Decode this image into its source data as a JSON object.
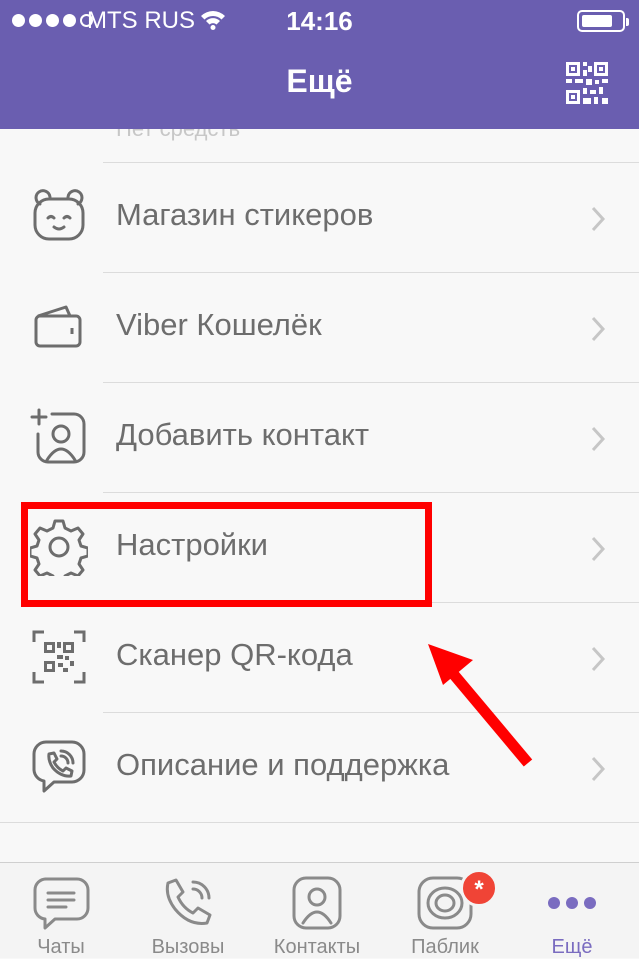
{
  "status_bar": {
    "carrier": "MTS RUS",
    "time": "14:16",
    "battery_level": 0.8
  },
  "header": {
    "title": "Ещё"
  },
  "menu": {
    "balance_text": "Нет средств",
    "items": [
      {
        "label": "Магазин стикеров",
        "icon": "sticker-bear-icon"
      },
      {
        "label": "Viber Кошелёк",
        "icon": "wallet-icon"
      },
      {
        "label": "Добавить контакт",
        "icon": "add-contact-icon"
      },
      {
        "label": "Настройки",
        "icon": "gear-icon"
      },
      {
        "label": "Сканер QR-кода",
        "icon": "qr-scanner-icon"
      },
      {
        "label": "Описание и поддержка",
        "icon": "viber-icon"
      }
    ]
  },
  "tabbar": {
    "tabs": [
      {
        "label": "Чаты",
        "icon": "chat-icon"
      },
      {
        "label": "Вызовы",
        "icon": "phone-icon"
      },
      {
        "label": "Контакты",
        "icon": "contacts-icon"
      },
      {
        "label": "Паблик",
        "icon": "public-icon",
        "badge": "*"
      },
      {
        "label": "Ещё",
        "icon": "more-icon",
        "active": true
      }
    ]
  },
  "colors": {
    "header": "#6a5eb0",
    "accent": "#7a6cc0",
    "highlight": "#ff0000",
    "badge": "#f04436"
  }
}
